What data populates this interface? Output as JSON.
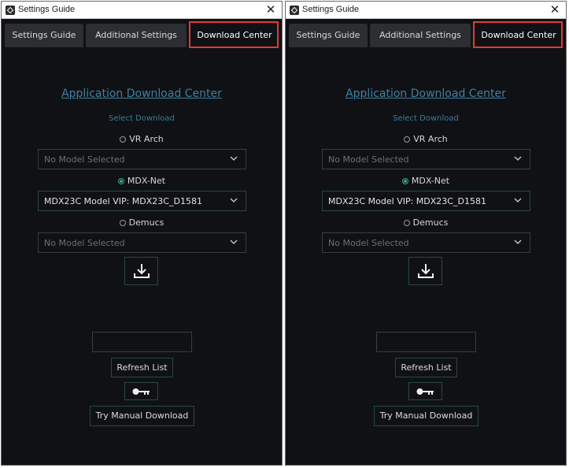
{
  "window": {
    "title": "Settings Guide",
    "close_glyph": "✕"
  },
  "tabs": [
    {
      "label": "Settings Guide"
    },
    {
      "label": "Additional Settings"
    },
    {
      "label": "Download Center",
      "active": true
    }
  ],
  "download_center": {
    "heading": "Application Download Center",
    "select_label": "Select Download",
    "options": [
      {
        "label": "VR Arch",
        "selected": false,
        "model": "No Model Selected"
      },
      {
        "label": "MDX-Net",
        "selected": true,
        "model": "MDX23C Model VIP: MDX23C_D1581"
      },
      {
        "label": "Demucs",
        "selected": false,
        "model": "No Model Selected"
      }
    ],
    "download_icon": "download-icon",
    "input_value": "",
    "refresh_label": "Refresh List",
    "key_icon": "key-icon",
    "manual_label": "Try Manual Download"
  },
  "colors": {
    "background": "#101114",
    "tab": "#2d2e31",
    "heading": "#3f7fa6",
    "accent_border": "#264a3e",
    "radio_selected": "#39a77b",
    "highlight": "#e23a3a"
  }
}
